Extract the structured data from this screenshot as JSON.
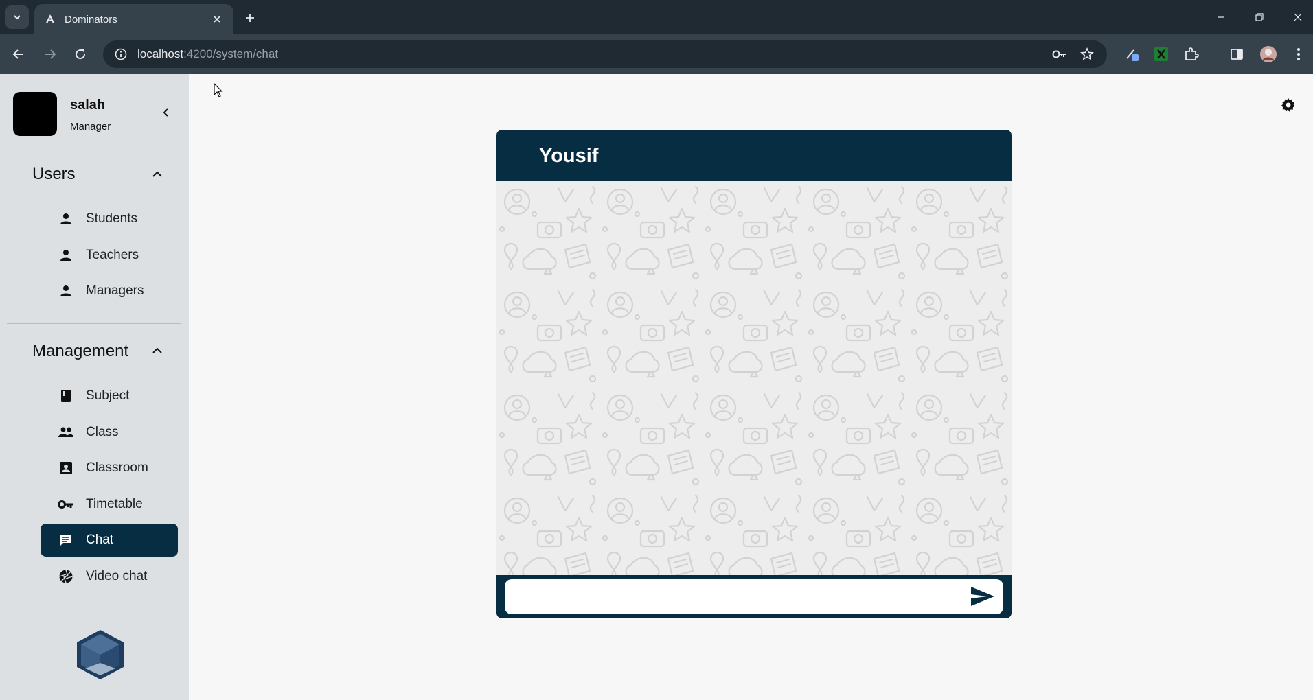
{
  "browser": {
    "tab_title": "Dominators",
    "url_host": "localhost",
    "url_path": ":4200/system/chat"
  },
  "user": {
    "name": "salah",
    "role": "Manager"
  },
  "sidebar": {
    "sections": [
      {
        "title": "Users",
        "items": [
          {
            "label": "Students",
            "icon": "person-icon"
          },
          {
            "label": "Teachers",
            "icon": "person-icon"
          },
          {
            "label": "Managers",
            "icon": "person-icon"
          }
        ]
      },
      {
        "title": "Management",
        "items": [
          {
            "label": "Subject",
            "icon": "book-icon"
          },
          {
            "label": "Class",
            "icon": "group-icon"
          },
          {
            "label": "Classroom",
            "icon": "contact-card-icon"
          },
          {
            "label": "Timetable",
            "icon": "key-icon"
          },
          {
            "label": "Chat",
            "icon": "chat-icon",
            "active": true
          },
          {
            "label": "Video chat",
            "icon": "camera-shutter-icon"
          }
        ]
      }
    ]
  },
  "chat": {
    "contact_name": "Yousif",
    "input_value": ""
  },
  "colors": {
    "primary": "#072d42",
    "sidebar_bg": "#dde0e3",
    "chrome_dark": "#202a33",
    "chrome_toolbar": "#35414b"
  }
}
